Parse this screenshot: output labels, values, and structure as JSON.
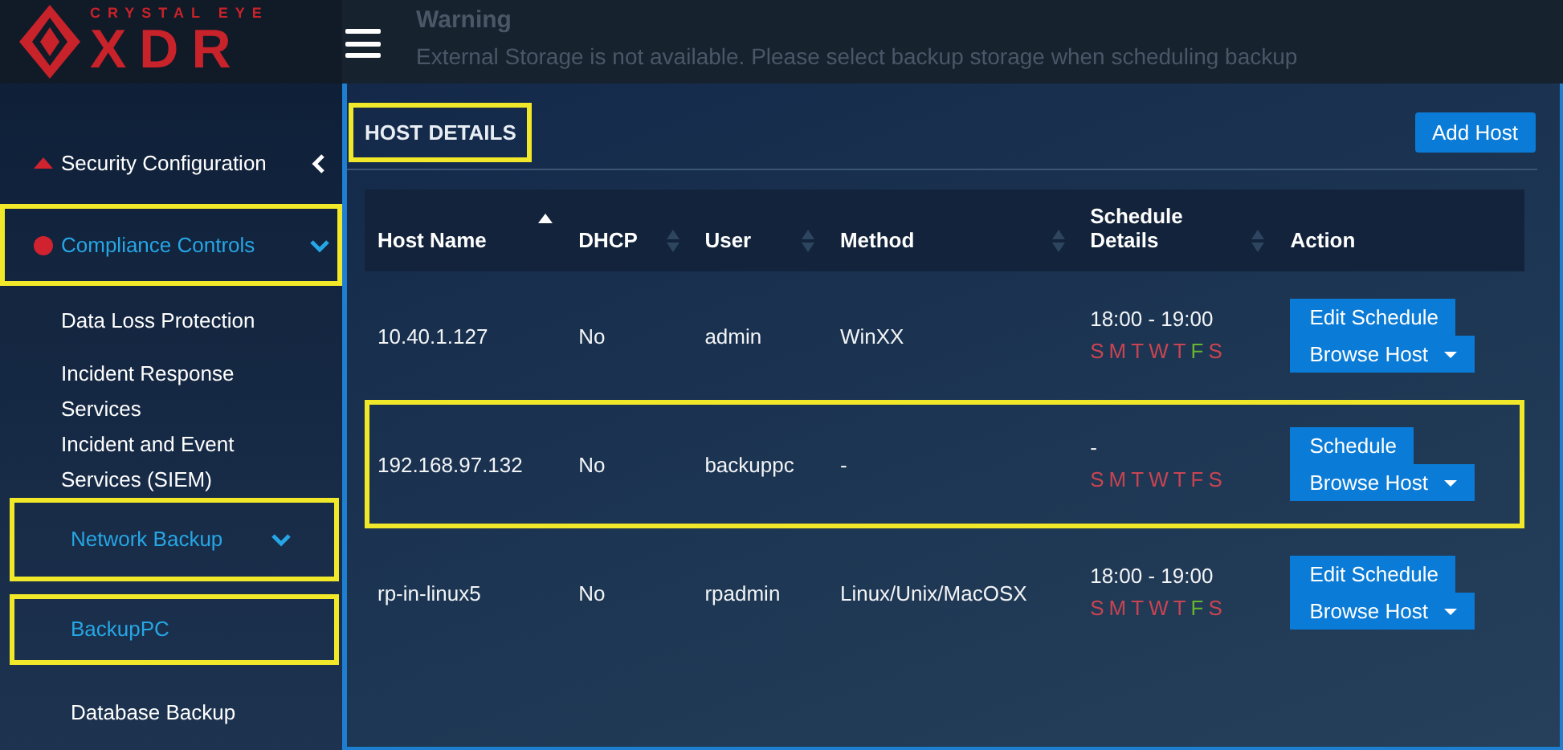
{
  "logo": {
    "tagline": "CRYSTAL EYE",
    "wordmark": "XDR"
  },
  "warning": {
    "title": "Warning",
    "message": "External Storage is not available. Please select backup storage when scheduling backup"
  },
  "sidebar": {
    "items": [
      {
        "kind": "section",
        "label": "Security Configuration",
        "expanded": false,
        "selected": false,
        "highlighted": false
      },
      {
        "kind": "section",
        "label": "Compliance Controls",
        "expanded": true,
        "selected": true,
        "highlighted": true
      },
      {
        "kind": "link",
        "label": "Data Loss Protection",
        "selected": false,
        "highlighted": false
      },
      {
        "kind": "link",
        "label": "Incident Response Services",
        "selected": false,
        "highlighted": false
      },
      {
        "kind": "link",
        "label": "Incident and Event Services (SIEM)",
        "selected": false,
        "highlighted": false
      },
      {
        "kind": "group",
        "label": "Network Backup",
        "expanded": true,
        "selected": true,
        "highlighted": true
      },
      {
        "kind": "sublink",
        "label": "BackupPC",
        "selected": true,
        "highlighted": true
      },
      {
        "kind": "sublink",
        "label": "Database Backup",
        "selected": false,
        "highlighted": false
      }
    ]
  },
  "panel": {
    "title": "HOST DETAILS",
    "title_highlighted": true,
    "add_button": "Add Host"
  },
  "table": {
    "columns": [
      {
        "label": "Host Name",
        "sortable": true,
        "sorted": true
      },
      {
        "label": "DHCP",
        "sortable": true,
        "sorted": false
      },
      {
        "label": "User",
        "sortable": true,
        "sorted": false
      },
      {
        "label": "Method",
        "sortable": true,
        "sorted": false
      },
      {
        "label": "Schedule Details",
        "sortable": true,
        "sorted": false
      },
      {
        "label": "Action",
        "sortable": false,
        "sorted": false
      }
    ],
    "rows": [
      {
        "host": "10.40.1.127",
        "dhcp": "No",
        "user": "admin",
        "method": "WinXX",
        "time": "18:00 - 19:00",
        "highlighted": false,
        "days": [
          {
            "letter": "S",
            "on": false
          },
          {
            "letter": "M",
            "on": false
          },
          {
            "letter": "T",
            "on": false
          },
          {
            "letter": "W",
            "on": false
          },
          {
            "letter": "T",
            "on": false
          },
          {
            "letter": "F",
            "on": true
          },
          {
            "letter": "S",
            "on": false
          }
        ],
        "schedule_button": "Edit Schedule",
        "browse_button": "Browse Host"
      },
      {
        "host": "192.168.97.132",
        "dhcp": "No",
        "user": "backuppc",
        "method": "-",
        "time": "-",
        "highlighted": true,
        "days": [
          {
            "letter": "S",
            "on": false
          },
          {
            "letter": "M",
            "on": false
          },
          {
            "letter": "T",
            "on": false
          },
          {
            "letter": "W",
            "on": false
          },
          {
            "letter": "T",
            "on": false
          },
          {
            "letter": "F",
            "on": false
          },
          {
            "letter": "S",
            "on": false
          }
        ],
        "schedule_button": "Schedule",
        "browse_button": "Browse Host"
      },
      {
        "host": "rp-in-linux5",
        "dhcp": "No",
        "user": "rpadmin",
        "method": "Linux/Unix/MacOSX",
        "time": "18:00 - 19:00",
        "highlighted": false,
        "days": [
          {
            "letter": "S",
            "on": false
          },
          {
            "letter": "M",
            "on": false
          },
          {
            "letter": "T",
            "on": false
          },
          {
            "letter": "W",
            "on": false
          },
          {
            "letter": "T",
            "on": false
          },
          {
            "letter": "F",
            "on": true
          },
          {
            "letter": "S",
            "on": false
          }
        ],
        "schedule_button": "Edit Schedule",
        "browse_button": "Browse Host"
      }
    ]
  }
}
